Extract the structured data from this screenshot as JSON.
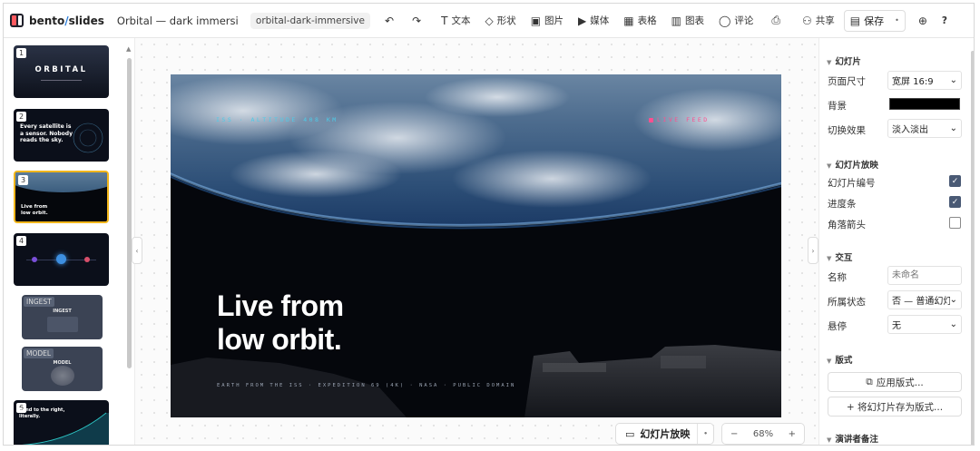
{
  "app": {
    "brand_main": "bento",
    "brand_sep": "/",
    "brand_sub": "slides",
    "doc_title": "Orbital — dark immersive template",
    "slug": "orbital-dark-immersive"
  },
  "toolbar": {
    "text": "文本",
    "shape": "形状",
    "image": "图片",
    "media": "媒体",
    "table": "表格",
    "chart": "图表",
    "comment": "评论",
    "share": "共享",
    "save": "保存",
    "help": "?"
  },
  "slides": [
    {
      "num": "1",
      "title": "ORBITAL"
    },
    {
      "num": "2",
      "title": "Every satellite is a sensor. Nobody reads the sky."
    },
    {
      "num": "3",
      "title": "Live from low orbit."
    },
    {
      "num": "4"
    },
    {
      "label": "INGEST",
      "title": "INGEST"
    },
    {
      "label": "MODEL",
      "title": "MODEL"
    },
    {
      "num": "6",
      "title": "Bend to the right, literally."
    }
  ],
  "current_slide": {
    "headline_1": "Live from",
    "headline_2": "low orbit.",
    "caption_left": "ISS · ALTITUDE 408 KM",
    "caption_right": "LIVE FEED",
    "footer": "EARTH FROM THE ISS · EXPEDITION 69 (4K) · NASA · PUBLIC DOMAIN"
  },
  "bottom": {
    "present": "幻灯片放映",
    "zoom": "68%",
    "minus": "−",
    "plus": "+"
  },
  "panel": {
    "sec_slide": "幻灯片",
    "page_size_label": "页面尺寸",
    "page_size": "宽屏 16:9",
    "background_label": "背景",
    "background_color": "#000000",
    "transition_label": "切换效果",
    "transition": "淡入淡出",
    "sec_show": "幻灯片放映",
    "slide_number_label": "幻灯片编号",
    "slide_number": true,
    "progress_label": "进度条",
    "progress": true,
    "corner_label": "角落箭头",
    "corner": false,
    "sec_interact": "交互",
    "name_label": "名称",
    "name_placeholder": "未命名",
    "state_label": "所属状态",
    "state": "否 — 普通幻灯片",
    "hover_label": "悬停",
    "hover": "无",
    "sec_layout": "版式",
    "apply_layout": "应用版式...",
    "save_layout": "+ 将幻灯片存为版式...",
    "sec_notes": "演讲者备注"
  },
  "colors": {
    "accent": "#2a7cd9",
    "selected_border": "#f2b61b",
    "checkbox": "#4a5a75"
  }
}
